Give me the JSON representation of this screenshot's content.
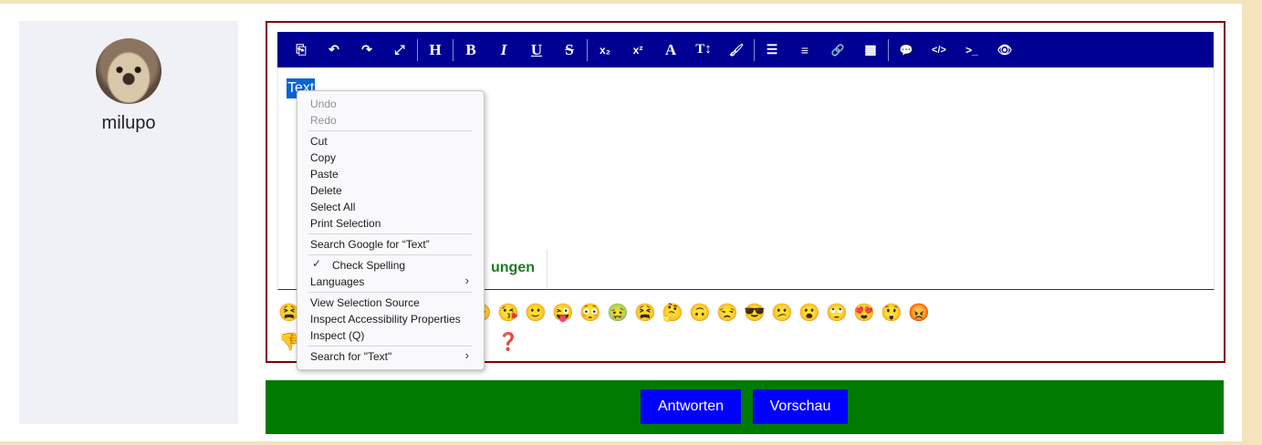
{
  "profile": {
    "username": "milupo"
  },
  "toolbar": {
    "buttons": [
      {
        "name": "source-icon",
        "glyph": "⎘"
      },
      {
        "name": "undo-icon",
        "glyph": "↶"
      },
      {
        "name": "redo-icon",
        "glyph": "↷"
      },
      {
        "name": "fullscreen-icon",
        "glyph": "⤢"
      },
      {
        "name": "heading-icon",
        "glyph": "H"
      },
      {
        "name": "bold-icon",
        "glyph": "B"
      },
      {
        "name": "italic-icon",
        "glyph": "I"
      },
      {
        "name": "underline-icon",
        "glyph": "U"
      },
      {
        "name": "strikethrough-icon",
        "glyph": "S"
      },
      {
        "name": "subscript-icon",
        "glyph": "x₂"
      },
      {
        "name": "superscript-icon",
        "glyph": "x²"
      },
      {
        "name": "font-icon",
        "glyph": "A"
      },
      {
        "name": "font-size-icon",
        "glyph": "T↕"
      },
      {
        "name": "brush-icon",
        "glyph": "🖌"
      },
      {
        "name": "list-icon",
        "glyph": "☰"
      },
      {
        "name": "align-icon",
        "glyph": "≡"
      },
      {
        "name": "link-icon",
        "glyph": "🔗"
      },
      {
        "name": "table-icon",
        "glyph": "▦"
      },
      {
        "name": "comment-icon",
        "glyph": "💬"
      },
      {
        "name": "code-icon",
        "glyph": "</>"
      },
      {
        "name": "terminal-icon",
        "glyph": ">_"
      },
      {
        "name": "spoiler-icon",
        "glyph": "👁"
      }
    ]
  },
  "editor": {
    "selected_text": "Text",
    "tab_label_partial": "ungen"
  },
  "emojis": {
    "row1": [
      "😫",
      "😠",
      "😘",
      "🙂",
      "😜",
      "😳",
      "🤢",
      "😫",
      "🤔",
      "🙃",
      "😒",
      "😎",
      "😕",
      "😮",
      "🙄",
      "😍",
      "😲",
      "😡"
    ],
    "row1_left": "😫",
    "row2_left": "👎",
    "question": "❓"
  },
  "actions": {
    "reply": "Antworten",
    "preview": "Vorschau"
  },
  "context_menu": {
    "undo": "Undo",
    "redo": "Redo",
    "cut": "Cut",
    "copy": "Copy",
    "paste": "Paste",
    "delete": "Delete",
    "select_all": "Select All",
    "print_selection": "Print Selection",
    "search_google": "Search Google for “Text”",
    "check_spelling": "Check Spelling",
    "languages": "Languages",
    "view_selection_source": "View Selection Source",
    "inspect_accessibility": "Inspect Accessibility Properties",
    "inspect": "Inspect (Q)",
    "search_for": "Search for \"Text\""
  },
  "colors": {
    "toolbar_bg": "#000093",
    "frame_border": "#800000",
    "action_bar": "#007a00",
    "button_bg": "#0000ff",
    "selection": "#0a63d4"
  }
}
